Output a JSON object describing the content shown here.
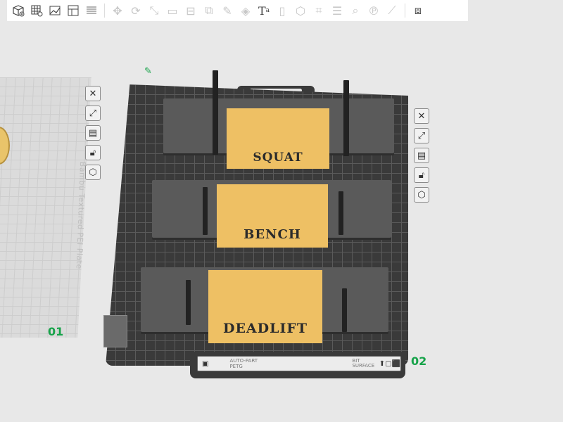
{
  "toolbar": {
    "items": [
      {
        "name": "add-cube-icon",
        "glyph": "⬚"
      },
      {
        "name": "add-grid-icon",
        "glyph": "▦"
      },
      {
        "name": "auto-orient-icon",
        "glyph": "⤢"
      },
      {
        "name": "arrange-icon",
        "glyph": "▤"
      },
      {
        "name": "layers-icon",
        "glyph": "≣"
      },
      {
        "name": "move-icon",
        "glyph": "✥",
        "disabled": true
      },
      {
        "name": "rotate-icon",
        "glyph": "⟳",
        "disabled": true
      },
      {
        "name": "scale-icon",
        "glyph": "⤡",
        "disabled": true
      },
      {
        "name": "lay-on-face-icon",
        "glyph": "▭",
        "disabled": true
      },
      {
        "name": "cut-icon",
        "glyph": "⊟",
        "disabled": true
      },
      {
        "name": "boolean-icon",
        "glyph": "⧉",
        "disabled": true
      },
      {
        "name": "support-paint-icon",
        "glyph": "✎",
        "disabled": true
      },
      {
        "name": "color-paint-icon",
        "glyph": "◈",
        "disabled": true
      },
      {
        "name": "text-icon",
        "glyph": "T",
        "disabled": false
      },
      {
        "name": "slot-icon",
        "glyph": "▯",
        "disabled": true
      },
      {
        "name": "assembly-icon",
        "glyph": "⬡",
        "disabled": true
      },
      {
        "name": "measure-icon",
        "glyph": "⌗",
        "disabled": true
      },
      {
        "name": "stack-icon",
        "glyph": "☰",
        "disabled": true
      },
      {
        "name": "search-q-icon",
        "glyph": "Q",
        "disabled": true
      },
      {
        "name": "search-p-icon",
        "glyph": "P",
        "disabled": true
      },
      {
        "name": "ruler-icon",
        "glyph": "⟋",
        "disabled": true
      },
      {
        "name": "assembly-view-icon",
        "glyph": "⧈"
      }
    ]
  },
  "plates": {
    "left_label": "01",
    "main_label": "02",
    "main_name": "Bambu Textured PEI Plate"
  },
  "parts": {
    "squat": "SQUAT",
    "bench": "BENCH",
    "deadlift": "DEADLIFT"
  },
  "label_strip": {
    "text1": "AUTO-PART PETG",
    "text2": "BIT SURFACE"
  },
  "side_icons": [
    "close-icon",
    "auto-orient-icon",
    "arrange-icon",
    "lock-icon",
    "settings-icon"
  ],
  "colors": {
    "plate_dark": "#3a3a3a",
    "part_gray": "#5a5a5a",
    "panel_yellow": "#eec064",
    "plate_label_green": "#17a34a"
  }
}
